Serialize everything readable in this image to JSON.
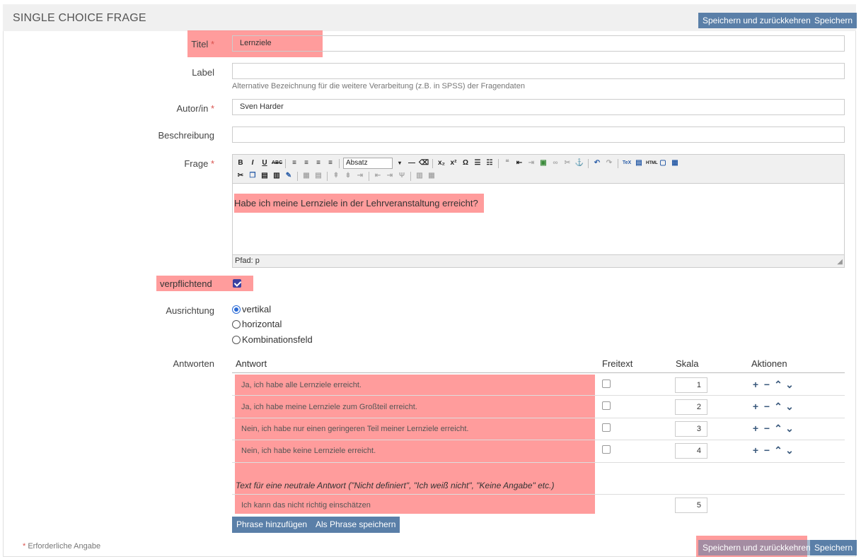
{
  "header": {
    "title": "SINGLE CHOICE FRAGE",
    "save_return_label": "Speichern und zurückkehren",
    "save_label": "Speichern"
  },
  "form": {
    "title": {
      "label": "Titel",
      "required_mark": "*",
      "value": "Lernziele"
    },
    "label_field": {
      "label": "Label",
      "value": "",
      "help": "Alternative Bezeichnung für die weitere Verarbeitung (z.B. in SPSS) der Fragendaten"
    },
    "author": {
      "label": "Autor/in",
      "required_mark": "*",
      "value": "Sven Harder"
    },
    "description": {
      "label": "Beschreibung",
      "value": ""
    },
    "question": {
      "label": "Frage",
      "required_mark": "*",
      "format_select": "Absatz",
      "text": "Habe ich meine Lernziele in der Lehrveranstaltung erreicht?",
      "path": "Pfad: p"
    },
    "mandatory": {
      "label": "verpflichtend",
      "checked": true
    },
    "orientation": {
      "label": "Ausrichtung",
      "options": [
        "vertikal",
        "horizontal",
        "Kombinationsfeld"
      ],
      "selected": "vertikal"
    }
  },
  "answers": {
    "label": "Antworten",
    "headers": {
      "answer": "Antwort",
      "freetext": "Freitext",
      "scale": "Skala",
      "actions": "Aktionen"
    },
    "rows": [
      {
        "text": "Ja, ich habe alle Lernziele erreicht.",
        "freetext": false,
        "scale": "1"
      },
      {
        "text": "Ja, ich habe meine Lernziele zum Großteil erreicht.",
        "freetext": false,
        "scale": "2"
      },
      {
        "text": "Nein, ich habe nur einen geringeren Teil meiner Lernziele erreicht.",
        "freetext": false,
        "scale": "3"
      },
      {
        "text": "Nein, ich habe keine Lernziele erreicht.",
        "freetext": false,
        "scale": "4"
      }
    ],
    "neutral_label": "Text für eine neutrale Antwort (\"Nicht definiert\", \"Ich weiß nicht\", \"Keine Angabe\" etc.)",
    "neutral": {
      "text": "Ich kann das nicht richtig einschätzen",
      "scale": "5"
    },
    "add_phrase_label": "Phrase hinzufügen",
    "save_phrase_label": "Als Phrase speichern"
  },
  "footer": {
    "required_note": "Erforderliche Angabe",
    "required_mark": "*",
    "save_return_label": "Speichern und zurückkehren",
    "save_label": "Speichern"
  },
  "colors": {
    "button": "#5a7fa8",
    "highlight": "#ff5a5a",
    "required": "#d9534f",
    "action_icons": "#3b5a7d"
  },
  "icons": [
    "plus-icon",
    "minus-icon",
    "chevron-up-icon",
    "chevron-down-icon"
  ]
}
